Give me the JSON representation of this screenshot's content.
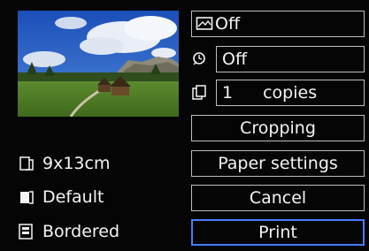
{
  "print_settings": {
    "image_effect": {
      "icon": "picture-effect-icon",
      "value": "Off"
    },
    "date_print": {
      "icon": "date-icon",
      "value": "Off"
    },
    "copies": {
      "icon": "copies-icon",
      "value": "1",
      "unit": "copies"
    }
  },
  "buttons": {
    "cropping": "Cropping",
    "paper_settings": "Paper settings",
    "cancel": "Cancel",
    "print": "Print"
  },
  "paper_info": {
    "size": {
      "icon": "paper-size-icon",
      "label": "9x13cm"
    },
    "type": {
      "icon": "paper-type-icon",
      "label": "Default"
    },
    "layout": {
      "icon": "layout-icon",
      "label": "Bordered"
    }
  },
  "selected_button": "print",
  "colors": {
    "background": "#050505",
    "border": "#bdbdbd",
    "selection": "#4a7cff",
    "text": "#f4f4f4"
  }
}
